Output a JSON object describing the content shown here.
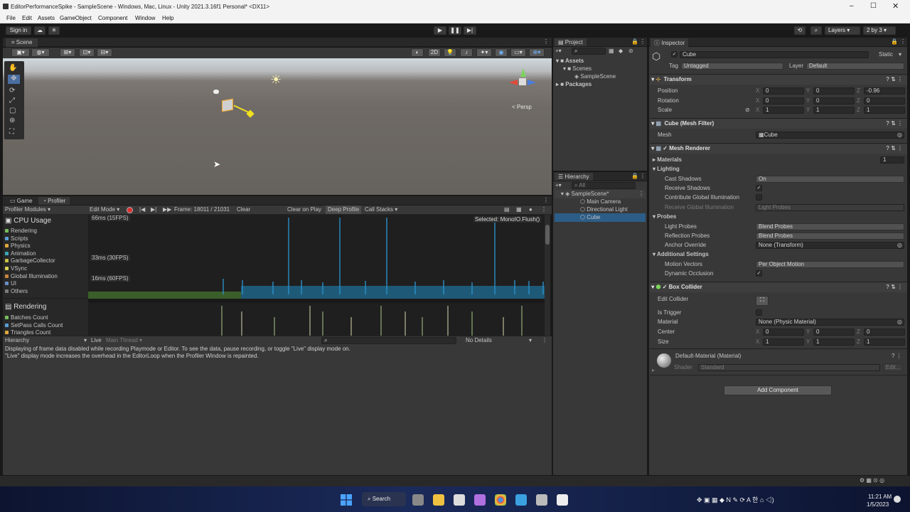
{
  "window": {
    "title": "EditorPerformanceSpike - SampleScene - Windows, Mac, Linux - Unity 2021.3.16f1 Personal* <DX11>"
  },
  "menu": [
    "File",
    "Edit",
    "Assets",
    "GameObject",
    "Component",
    "Window",
    "Help"
  ],
  "toolbar": {
    "sign_in": "Sign in",
    "layers": "Layers",
    "layout": "2 by 3"
  },
  "scene": {
    "tab": "Scene",
    "mode_2d": "2D",
    "persp": "< Persp"
  },
  "project": {
    "tab": "Project",
    "tree": [
      "Assets",
      "Scenes",
      "SampleScene",
      "Packages"
    ]
  },
  "hierarchy": {
    "tab": "Hierarchy",
    "search_placeholder": "All",
    "scene": "SampleScene*",
    "items": [
      "Main Camera",
      "Directional Light",
      "Cube"
    ]
  },
  "profiler": {
    "tabs": [
      "Game",
      "Profiler"
    ],
    "modules_label": "Profiler Modules",
    "mode": "Edit Mode",
    "frame": "Frame: 18011 / 21031",
    "clear": "Clear",
    "clear_on_play": "Clear on Play",
    "deep_profile": "Deep Profile",
    "call_stacks": "Call Stacks",
    "selected": "Selected: MonoIO.Flush()",
    "cpu": {
      "title": "CPU Usage",
      "items": [
        {
          "label": "Rendering",
          "color": "#78bd5c"
        },
        {
          "label": "Scripts",
          "color": "#5a9fd6"
        },
        {
          "label": "Physics",
          "color": "#e0a63c"
        },
        {
          "label": "Animation",
          "color": "#3aa7b8"
        },
        {
          "label": "GarbageCollector",
          "color": "#c7c046"
        },
        {
          "label": "VSync",
          "color": "#d6d055"
        },
        {
          "label": "Global Illumination",
          "color": "#c8863a"
        },
        {
          "label": "UI",
          "color": "#6a8ec7"
        },
        {
          "label": "Others",
          "color": "#7c7c7c"
        }
      ]
    },
    "markers": [
      "66ms (15FPS)",
      "33ms (30FPS)",
      "16ms (60FPS)"
    ],
    "rendering": {
      "title": "Rendering",
      "items": [
        {
          "label": "Batches Count",
          "color": "#78bd5c"
        },
        {
          "label": "SetPass Calls Count",
          "color": "#5a9fd6"
        },
        {
          "label": "Triangles Count",
          "color": "#e0a63c"
        }
      ]
    },
    "bottom": {
      "view": "Hierarchy",
      "live": "Live",
      "thread": "Main Thread",
      "details": "No Details"
    },
    "message": "Displaying of frame data disabled while recording Playmode or Editor. To see the data, pause recording, or toggle \"Live\" display mode on.\n\"Live\" display mode increases the overhead in the EditorLoop when the Profiler Window is repainted."
  },
  "inspector": {
    "tab": "Inspector",
    "name": "Cube",
    "static": "Static",
    "tag_label": "Tag",
    "tag": "Untagged",
    "layer_label": "Layer",
    "layer": "Default",
    "transform": {
      "title": "Transform",
      "rows": [
        {
          "label": "Position",
          "x": "0",
          "y": "0",
          "z": "-0.96"
        },
        {
          "label": "Rotation",
          "x": "0",
          "y": "0",
          "z": "0"
        },
        {
          "label": "Scale",
          "x": "1",
          "y": "1",
          "z": "1"
        }
      ]
    },
    "mesh_filter": {
      "title": "Cube (Mesh Filter)",
      "mesh_label": "Mesh",
      "mesh": "Cube"
    },
    "mesh_renderer": {
      "title": "Mesh Renderer",
      "materials": "Materials",
      "materials_count": "1",
      "lighting": "Lighting",
      "cast_shadows_label": "Cast Shadows",
      "cast_shadows": "On",
      "receive_shadows": "Receive Shadows",
      "contribute_gi": "Contribute Global Illumination",
      "receive_gi_label": "Receive Global Illumination",
      "receive_gi": "Light Probes",
      "probes": "Probes",
      "light_probes_label": "Light Probes",
      "light_probes": "Blend Probes",
      "reflection_probes_label": "Reflection Probes",
      "reflection_probes": "Blend Probes",
      "anchor_label": "Anchor Override",
      "anchor": "None (Transform)",
      "additional": "Additional Settings",
      "motion_label": "Motion Vectors",
      "motion": "Per Object Motion",
      "occlusion": "Dynamic Occlusion"
    },
    "box_collider": {
      "title": "Box Collider",
      "edit": "Edit Collider",
      "trigger": "Is Trigger",
      "material_label": "Material",
      "material": "None (Physic Material)",
      "center": {
        "label": "Center",
        "x": "0",
        "y": "0",
        "z": "0"
      },
      "size": {
        "label": "Size",
        "x": "1",
        "y": "1",
        "z": "1"
      }
    },
    "material": {
      "name": "Default-Material (Material)",
      "shader_label": "Shader",
      "shader": "Standard",
      "edit": "Edit..."
    },
    "add_component": "Add Component"
  },
  "taskbar": {
    "search": "Search",
    "time": "11:21 AM",
    "date": "1/5/2023"
  }
}
